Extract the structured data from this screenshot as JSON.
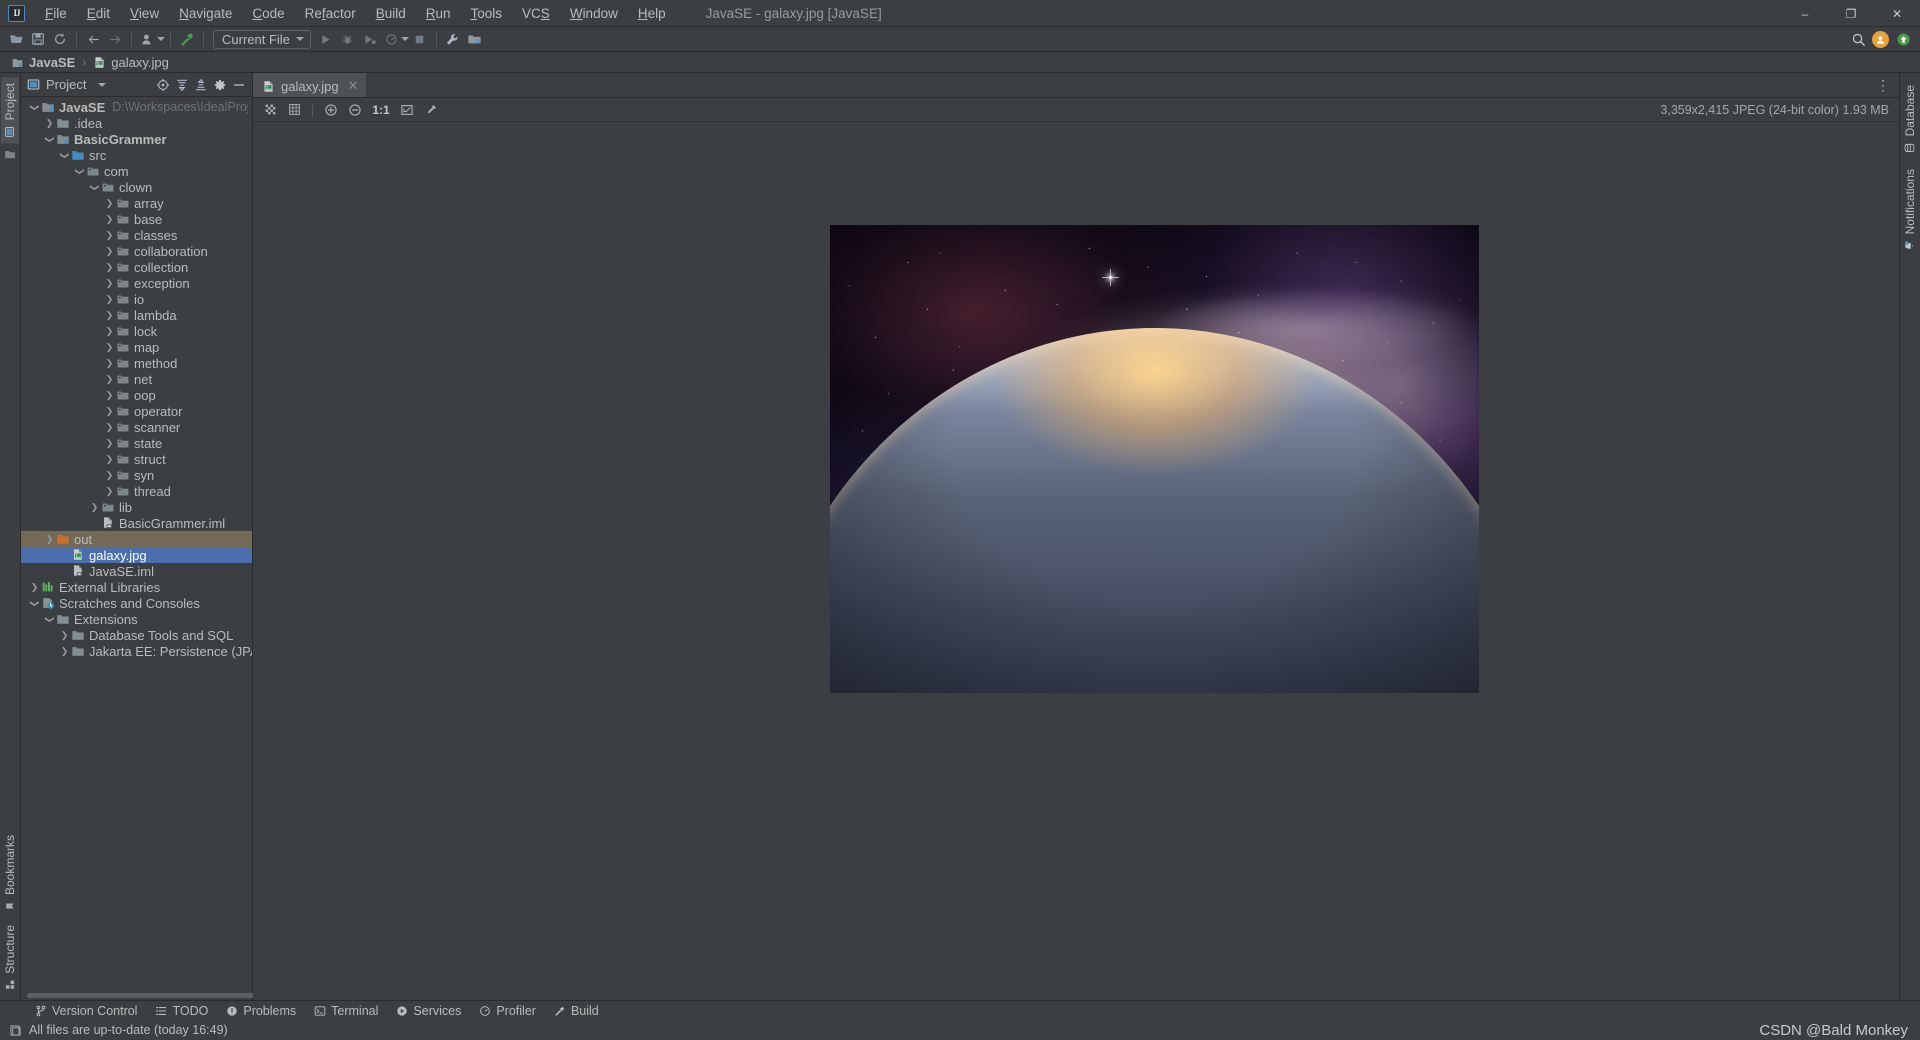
{
  "window": {
    "title": "JavaSE - galaxy.jpg [JavaSE]",
    "minimize": "–",
    "maximize": "❐",
    "close": "✕"
  },
  "menubar": {
    "logo": "IJ",
    "items": [
      {
        "label": "File"
      },
      {
        "label": "Edit"
      },
      {
        "label": "View"
      },
      {
        "label": "Navigate"
      },
      {
        "label": "Code"
      },
      {
        "label": "Refactor"
      },
      {
        "label": "Build"
      },
      {
        "label": "Run"
      },
      {
        "label": "Tools"
      },
      {
        "label": "VCS"
      },
      {
        "label": "Window"
      },
      {
        "label": "Help"
      }
    ]
  },
  "toolbar": {
    "open_icon": "open-folder-icon",
    "save_icon": "save-icon",
    "sync_icon": "sync-icon",
    "back_icon": "back-arrow-icon",
    "forward_icon": "forward-arrow-icon",
    "profile_icon": "user-profile-icon",
    "build_icon": "hammer-icon",
    "run_config": "Current File",
    "run_icon": "run-icon",
    "debug_icon": "debug-icon",
    "run_with_coverage_icon": "run-coverage-icon",
    "profile_dropdown_icon": "profiler-icon",
    "stop_icon": "stop-icon",
    "settings_icon": "wrench-icon",
    "project_structure_icon": "project-structure-icon",
    "search_icon": "search-icon",
    "account_icon": "account-avatar-icon",
    "updates_icon": "updates-icon"
  },
  "breadcrumb": {
    "items": [
      {
        "label": "JavaSE",
        "icon": "module-icon"
      },
      {
        "label": "galaxy.jpg",
        "icon": "image-file-icon"
      }
    ],
    "separator": "›"
  },
  "left_rail": {
    "top": [
      {
        "label": "Project",
        "icon": "project-icon",
        "active": true
      }
    ],
    "bottom": [
      {
        "label": "Bookmarks",
        "icon": "bookmark-icon"
      },
      {
        "label": "Structure",
        "icon": "structure-icon"
      }
    ]
  },
  "right_rail": {
    "items": [
      {
        "label": "Database",
        "icon": "database-icon"
      },
      {
        "label": "Notifications",
        "icon": "bell-icon"
      }
    ]
  },
  "project_panel": {
    "title": "Project",
    "dropdown_icon": "chevron-down-icon",
    "actions": [
      {
        "name": "select-opened-file-icon",
        "label": "⊕"
      },
      {
        "name": "expand-all-icon",
        "label": "⤓"
      },
      {
        "name": "collapse-all-icon",
        "label": "⤒"
      },
      {
        "name": "settings-gear-icon",
        "label": "⚙"
      },
      {
        "name": "hide-icon",
        "label": "—"
      }
    ],
    "tree": [
      {
        "label": "JavaSE",
        "sub": "D:\\Workspaces\\IdealProjects\\JavaS",
        "indent": 0,
        "arrow": "down",
        "icon": "module",
        "bold": true
      },
      {
        "label": ".idea",
        "indent": 1,
        "arrow": "right",
        "icon": "folder-grey"
      },
      {
        "label": "BasicGrammer",
        "indent": 1,
        "arrow": "down",
        "icon": "module",
        "bold": true
      },
      {
        "label": "src",
        "indent": 2,
        "arrow": "down",
        "icon": "folder-src"
      },
      {
        "label": "com",
        "indent": 3,
        "arrow": "down",
        "icon": "package"
      },
      {
        "label": "clown",
        "indent": 4,
        "arrow": "down",
        "icon": "package"
      },
      {
        "label": "array",
        "indent": 5,
        "arrow": "right",
        "icon": "package"
      },
      {
        "label": "base",
        "indent": 5,
        "arrow": "right",
        "icon": "package"
      },
      {
        "label": "classes",
        "indent": 5,
        "arrow": "right",
        "icon": "package"
      },
      {
        "label": "collaboration",
        "indent": 5,
        "arrow": "right",
        "icon": "package"
      },
      {
        "label": "collection",
        "indent": 5,
        "arrow": "right",
        "icon": "package"
      },
      {
        "label": "exception",
        "indent": 5,
        "arrow": "right",
        "icon": "package"
      },
      {
        "label": "io",
        "indent": 5,
        "arrow": "right",
        "icon": "package"
      },
      {
        "label": "lambda",
        "indent": 5,
        "arrow": "right",
        "icon": "package"
      },
      {
        "label": "lock",
        "indent": 5,
        "arrow": "right",
        "icon": "package"
      },
      {
        "label": "map",
        "indent": 5,
        "arrow": "right",
        "icon": "package"
      },
      {
        "label": "method",
        "indent": 5,
        "arrow": "right",
        "icon": "package"
      },
      {
        "label": "net",
        "indent": 5,
        "arrow": "right",
        "icon": "package"
      },
      {
        "label": "oop",
        "indent": 5,
        "arrow": "right",
        "icon": "package"
      },
      {
        "label": "operator",
        "indent": 5,
        "arrow": "right",
        "icon": "package"
      },
      {
        "label": "scanner",
        "indent": 5,
        "arrow": "right",
        "icon": "package"
      },
      {
        "label": "state",
        "indent": 5,
        "arrow": "right",
        "icon": "package"
      },
      {
        "label": "struct",
        "indent": 5,
        "arrow": "right",
        "icon": "package"
      },
      {
        "label": "syn",
        "indent": 5,
        "arrow": "right",
        "icon": "package"
      },
      {
        "label": "thread",
        "indent": 5,
        "arrow": "right",
        "icon": "package"
      },
      {
        "label": "lib",
        "indent": 4,
        "arrow": "right",
        "icon": "package"
      },
      {
        "label": "BasicGrammer.iml",
        "indent": 4,
        "arrow": "none",
        "icon": "iml"
      },
      {
        "label": "out",
        "indent": 1,
        "arrow": "right",
        "icon": "folder-orange",
        "highlight": "excluded"
      },
      {
        "label": "galaxy.jpg",
        "indent": 2,
        "arrow": "none",
        "icon": "image",
        "selected": true
      },
      {
        "label": "JavaSE.iml",
        "indent": 2,
        "arrow": "none",
        "icon": "iml"
      },
      {
        "label": "External Libraries",
        "indent": 0,
        "arrow": "right",
        "icon": "libraries"
      },
      {
        "label": "Scratches and Consoles",
        "indent": 0,
        "arrow": "down",
        "icon": "scratches"
      },
      {
        "label": "Extensions",
        "indent": 1,
        "arrow": "down",
        "icon": "folder-grey"
      },
      {
        "label": "Database Tools and SQL",
        "indent": 2,
        "arrow": "right",
        "icon": "folder-grey"
      },
      {
        "label": "Jakarta EE: Persistence (JPA)",
        "indent": 2,
        "arrow": "right",
        "icon": "folder-grey"
      }
    ]
  },
  "editor": {
    "tabs": [
      {
        "label": "galaxy.jpg",
        "icon": "image-file-icon",
        "close": "✕",
        "active": true
      }
    ],
    "options_icon": "more-options-icon",
    "image_toolbar": [
      {
        "name": "toggle-transparency-chessboard-icon",
        "label": "transparency"
      },
      {
        "name": "toggle-grid-icon",
        "label": "grid"
      },
      {
        "name": "zoom-in-icon",
        "label": "+"
      },
      {
        "name": "zoom-out-icon",
        "label": "−"
      },
      {
        "name": "actual-size-button",
        "label": "1:1"
      },
      {
        "name": "fit-to-window-icon",
        "label": "fit"
      },
      {
        "name": "color-picker-icon",
        "label": "eyedropper"
      }
    ],
    "image_info": "3,359x2,415 JPEG (24-bit color) 1.93 MB",
    "image_alt": "galaxy and earth horizon photograph"
  },
  "bottom_bar": {
    "items": [
      {
        "label": "Version Control",
        "icon": "branch-icon"
      },
      {
        "label": "TODO",
        "icon": "todo-list-icon"
      },
      {
        "label": "Problems",
        "icon": "problems-icon"
      },
      {
        "label": "Terminal",
        "icon": "terminal-icon"
      },
      {
        "label": "Services",
        "icon": "services-icon"
      },
      {
        "label": "Profiler",
        "icon": "profiler-icon"
      },
      {
        "label": "Build",
        "icon": "build-hammer-icon"
      }
    ]
  },
  "status_bar": {
    "message": "All files are up-to-date (today 16:49)",
    "icon": "vcs-status-icon",
    "watermark": "CSDN @Bald Monkey"
  },
  "colors": {
    "background": "#3c3f41",
    "selection": "#4b6eaf",
    "excluded_row": "#726a56",
    "accent_blue": "#4b8fc7",
    "text": "#bbbbbb"
  }
}
